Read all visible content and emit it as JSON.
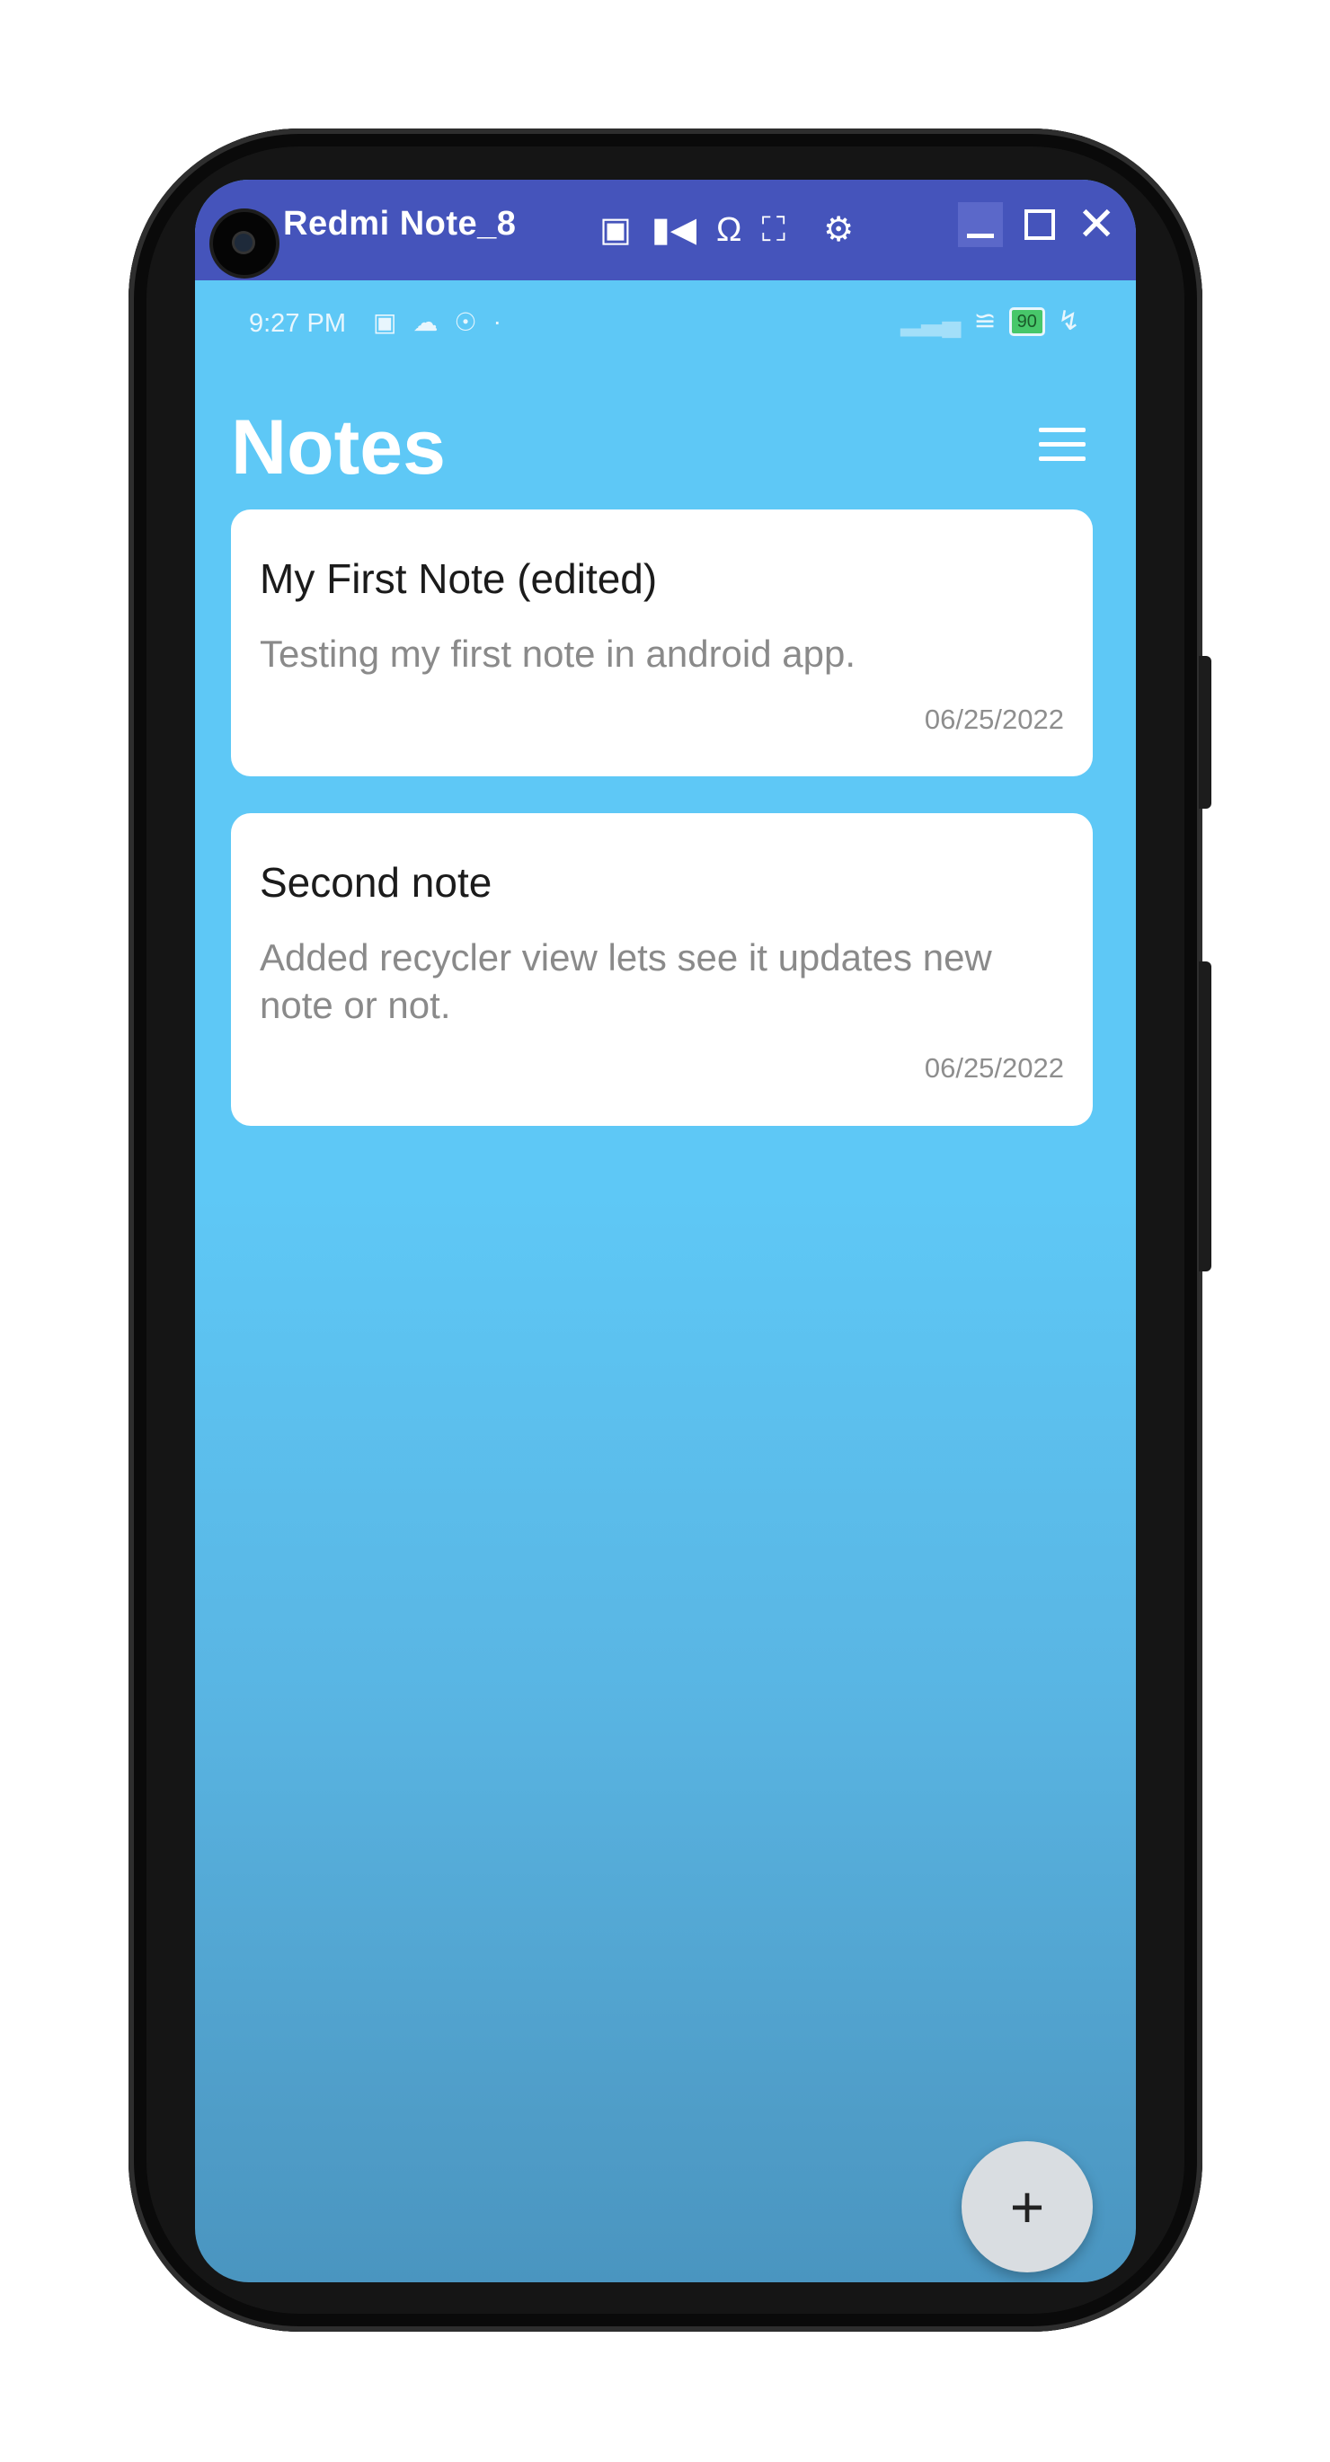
{
  "window": {
    "title": "Redmi Note_8",
    "toolbar_icons": [
      "camera-icon",
      "video-icon",
      "headphones-icon",
      "fullscreen-icon",
      "settings-icon"
    ],
    "controls": [
      "minimize",
      "maximize",
      "close"
    ]
  },
  "status_bar": {
    "time": "9:27 PM",
    "battery_level": "90"
  },
  "header": {
    "title": "Notes"
  },
  "notes": [
    {
      "title": "My First Note (edited)",
      "body": "Testing my first note in android app.",
      "date": "06/25/2022"
    },
    {
      "title": "Second note",
      "body": "Added recycler view lets see it updates new note or not.",
      "date": "06/25/2022"
    }
  ],
  "fab": {
    "label": "+"
  },
  "colors": {
    "background": "#5ec8f6",
    "title_bar": "#4554bb",
    "card": "#ffffff",
    "fab": "#d9dde1"
  }
}
